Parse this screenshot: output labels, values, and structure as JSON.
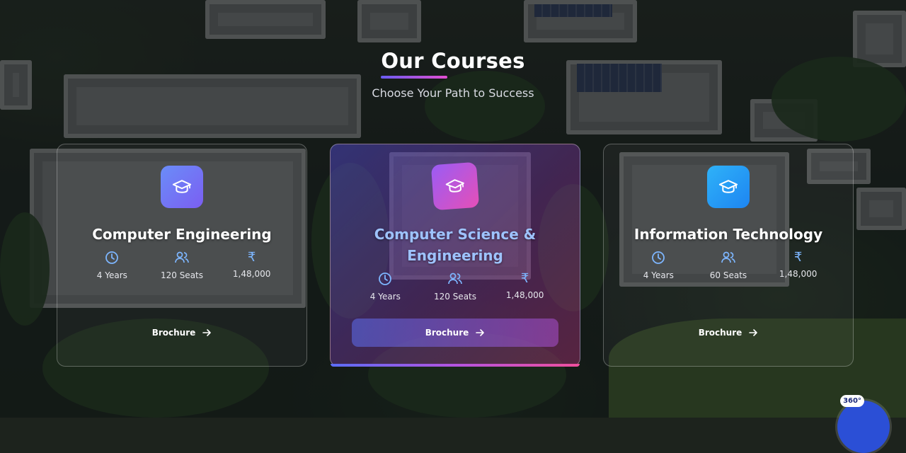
{
  "header": {
    "title": "Our Courses",
    "subtitle": "Choose Your Path to Success"
  },
  "colors": {
    "accent_start": "#6a5cf2",
    "accent_end": "#e24ed1",
    "icon_ce": "#6a8df8",
    "icon_cse": "#e54fb7",
    "icon_it": "#2fb2f8"
  },
  "courses": [
    {
      "name": "Computer Engineering",
      "icon": "graduation-cap-icon",
      "duration": "4 Years",
      "seats": "120 Seats",
      "currency_symbol": "₹",
      "fee": "1,48,000",
      "brochure_label": "Brochure",
      "highlighted": false
    },
    {
      "name": "Computer Science & Engineering",
      "icon": "graduation-cap-icon",
      "duration": "4 Years",
      "seats": "120 Seats",
      "currency_symbol": "₹",
      "fee": "1,48,000",
      "brochure_label": "Brochure",
      "highlighted": true
    },
    {
      "name": "Information Technology",
      "icon": "graduation-cap-icon",
      "duration": "4 Years",
      "seats": "60 Seats",
      "currency_symbol": "₹",
      "fee": "1,48,000",
      "brochure_label": "Brochure",
      "highlighted": false
    }
  ],
  "virtual_tour": {
    "badge": "360°"
  }
}
